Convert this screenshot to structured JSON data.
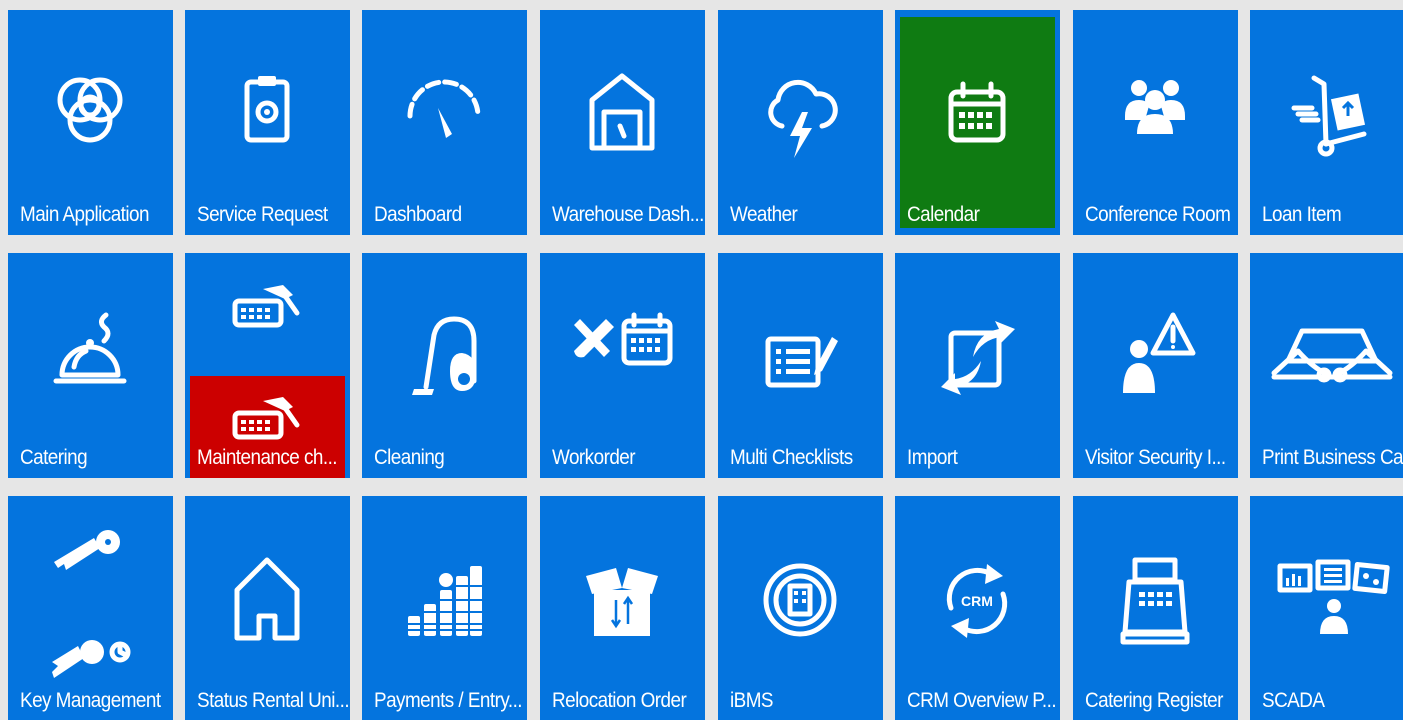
{
  "tiles": [
    {
      "label": "Main Application",
      "icon": "rings-icon"
    },
    {
      "label": "Service Request",
      "icon": "clipboard-gear-icon"
    },
    {
      "label": "Dashboard",
      "icon": "gauge-icon"
    },
    {
      "label": "Warehouse Dash...",
      "icon": "warehouse-icon"
    },
    {
      "label": "Weather",
      "icon": "storm-cloud-icon"
    },
    {
      "label": "Calendar",
      "icon": "calendar-icon",
      "state": "selected"
    },
    {
      "label": "Conference Room",
      "icon": "people-group-icon"
    },
    {
      "label": "Loan Item",
      "icon": "hand-truck-icon"
    },
    {
      "label": "Catering",
      "icon": "cloche-icon"
    },
    {
      "label": "Maintenance ch...",
      "icon": "keyboard-hammer-icon",
      "state": "alert"
    },
    {
      "label": "Cleaning",
      "icon": "vacuum-cleaner-icon"
    },
    {
      "label": "Workorder",
      "icon": "tools-calendar-icon"
    },
    {
      "label": "Multi Checklists",
      "icon": "checklist-icon"
    },
    {
      "label": "Import",
      "icon": "import-arrows-icon"
    },
    {
      "label": "Visitor Security I...",
      "icon": "person-warning-icon"
    },
    {
      "label": "Print Business Ca",
      "icon": "hands-card-icon"
    },
    {
      "label": "Key Management",
      "icon": "keys-icon"
    },
    {
      "label": "Status Rental Uni...",
      "icon": "house-outline-icon"
    },
    {
      "label": "Payments / Entry...",
      "icon": "coin-stacks-icon"
    },
    {
      "label": "Relocation Order",
      "icon": "moving-box-icon"
    },
    {
      "label": "iBMS",
      "icon": "building-circle-icon"
    },
    {
      "label": "CRM Overview P...",
      "icon": "crm-cycle-icon"
    },
    {
      "label": "Catering Register",
      "icon": "cash-register-icon"
    },
    {
      "label": "SCADA",
      "icon": "scada-screens-icon"
    }
  ],
  "colors": {
    "tile": "#0474de",
    "selected": "#0f7b12",
    "alert": "#cc0000",
    "background": "#e6e6e6"
  },
  "crm_icon_text": "CRM"
}
